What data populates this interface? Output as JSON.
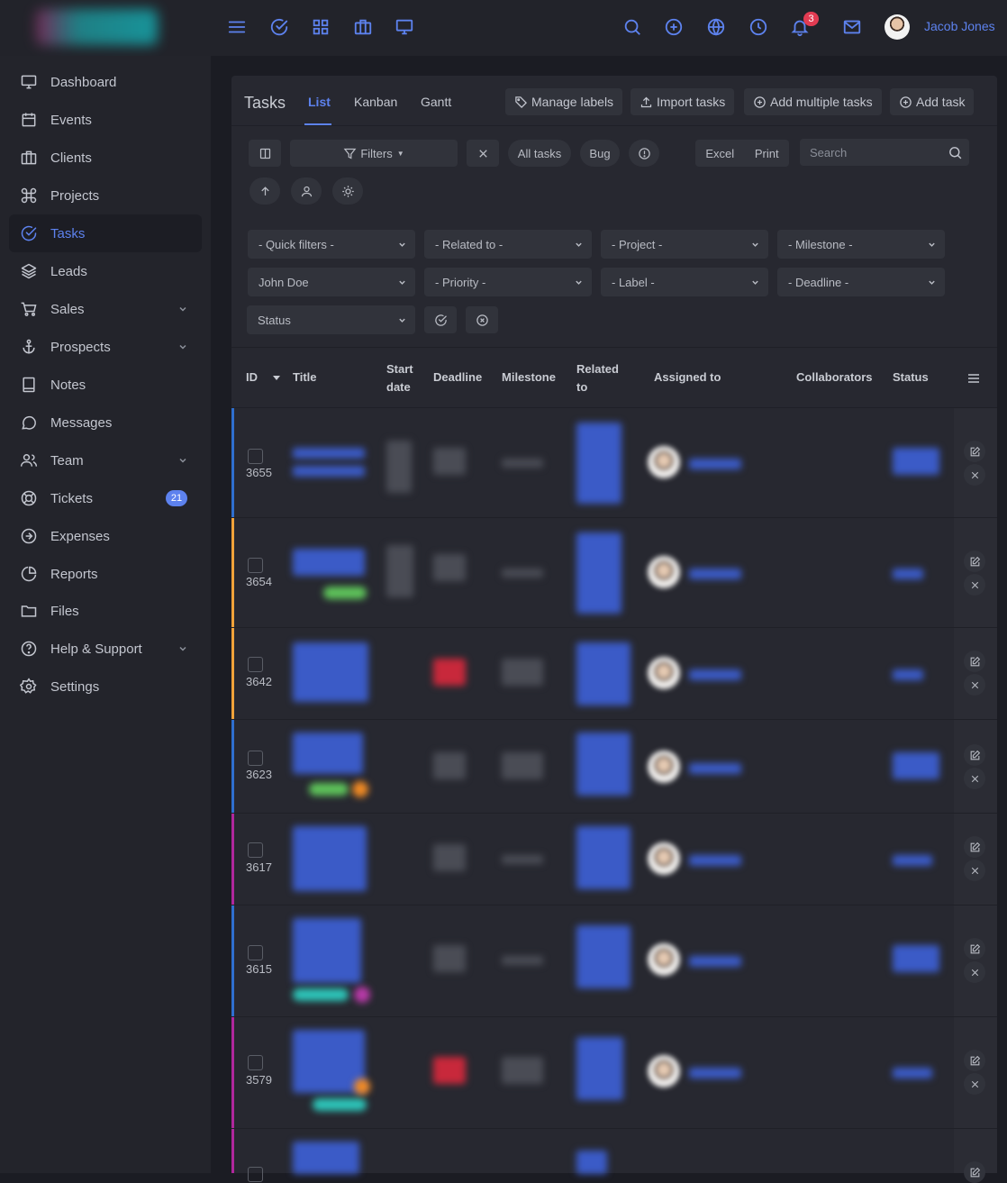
{
  "topbar": {
    "notification_count": "3",
    "user_name": "Jacob Jones"
  },
  "sidebar": {
    "items": [
      {
        "label": "Dashboard",
        "icon": "monitor-icon"
      },
      {
        "label": "Events",
        "icon": "calendar-icon"
      },
      {
        "label": "Clients",
        "icon": "briefcase-icon"
      },
      {
        "label": "Projects",
        "icon": "command-icon"
      },
      {
        "label": "Tasks",
        "icon": "check-circle-icon",
        "active": true
      },
      {
        "label": "Leads",
        "icon": "layers-icon"
      },
      {
        "label": "Sales",
        "icon": "cart-icon",
        "expandable": true
      },
      {
        "label": "Prospects",
        "icon": "anchor-icon",
        "expandable": true
      },
      {
        "label": "Notes",
        "icon": "book-icon"
      },
      {
        "label": "Messages",
        "icon": "message-icon"
      },
      {
        "label": "Team",
        "icon": "users-icon",
        "expandable": true
      },
      {
        "label": "Tickets",
        "icon": "life-buoy-icon",
        "badge": "21"
      },
      {
        "label": "Expenses",
        "icon": "arrow-circle-icon"
      },
      {
        "label": "Reports",
        "icon": "pie-chart-icon"
      },
      {
        "label": "Files",
        "icon": "folder-icon"
      },
      {
        "label": "Help & Support",
        "icon": "help-circle-icon",
        "expandable": true
      },
      {
        "label": "Settings",
        "icon": "settings-icon"
      }
    ]
  },
  "panel": {
    "title": "Tasks",
    "tabs": [
      "List",
      "Kanban",
      "Gantt"
    ],
    "buttons": {
      "manage_labels": "Manage labels",
      "import_tasks": "Import tasks",
      "add_multiple_tasks": "Add multiple tasks",
      "add_task": "Add task"
    },
    "toolbar": {
      "filters": "Filters",
      "all_tasks": "All tasks",
      "bug": "Bug",
      "excel": "Excel",
      "print": "Print",
      "search_placeholder": "Search"
    },
    "filters": {
      "quick_filters": "- Quick filters -",
      "related_to": "- Related to -",
      "project": "- Project -",
      "milestone": "- Milestone -",
      "assignee": "John Doe",
      "priority": "- Priority -",
      "label": "- Label -",
      "deadline": "- Deadline -",
      "status": "Status"
    },
    "columns": {
      "id": "ID",
      "title": "Title",
      "start_date": "Start date",
      "deadline": "Deadline",
      "milestone": "Milestone",
      "related_to": "Related to",
      "assigned_to": "Assigned to",
      "collaborators": "Collaborators",
      "status": "Status"
    },
    "rows": [
      {
        "id": "3655"
      },
      {
        "id": "3654"
      },
      {
        "id": "3642"
      },
      {
        "id": "3623"
      },
      {
        "id": "3617"
      },
      {
        "id": "3615"
      },
      {
        "id": "3579"
      },
      {
        "id": ""
      }
    ]
  },
  "colors": {
    "accent": "#5d82ee",
    "background": "#1b1c23",
    "panel": "#272830",
    "sidebar": "#23242b",
    "badge_red": "#e23b52",
    "stripe_blue": "#2f6fcf",
    "stripe_orange": "#f0a23a",
    "stripe_magenta": "#b0279c"
  }
}
